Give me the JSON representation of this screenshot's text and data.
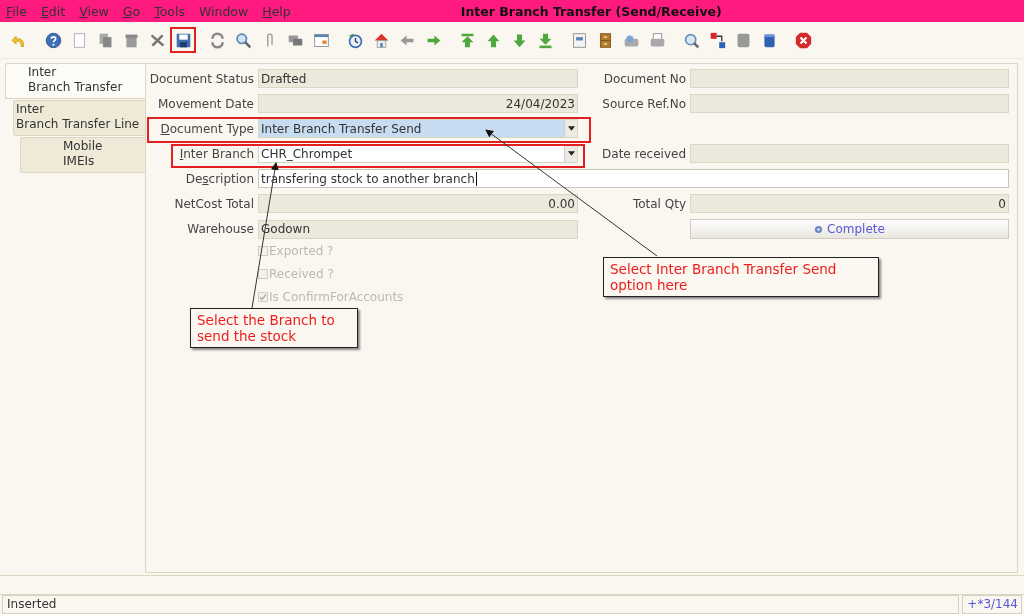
{
  "window": {
    "title": "Inter Branch Transfer (Send/Receive)"
  },
  "menu": [
    {
      "key": "F",
      "after": "ile"
    },
    {
      "key": "E",
      "after": "dit"
    },
    {
      "key": "V",
      "after": "iew"
    },
    {
      "key": "G",
      "after": "o"
    },
    {
      "key": "T",
      "after": "ools"
    },
    {
      "before": "Window"
    },
    {
      "key": "H",
      "after": "elp"
    }
  ],
  "toolbar": [
    [
      {
        "kind": "undo",
        "highlighted": false
      }
    ],
    [
      {
        "kind": "help",
        "highlighted": false
      },
      {
        "kind": "page",
        "highlighted": false
      },
      {
        "kind": "copy",
        "highlighted": false
      },
      {
        "kind": "trash",
        "highlighted": false
      },
      {
        "kind": "cross",
        "highlighted": false
      },
      {
        "kind": "floppy",
        "highlighted": true
      }
    ],
    [
      {
        "kind": "refresh",
        "highlighted": false
      },
      {
        "kind": "magnifier",
        "highlighted": false
      },
      {
        "kind": "paperclip",
        "highlighted": false
      },
      {
        "kind": "chat",
        "highlighted": false
      },
      {
        "kind": "grid",
        "highlighted": false
      }
    ],
    [
      {
        "kind": "history",
        "highlighted": false
      },
      {
        "kind": "house",
        "highlighted": false
      },
      {
        "kind": "left",
        "highlighted": false
      },
      {
        "kind": "right",
        "highlighted": false
      }
    ],
    [
      {
        "kind": "first",
        "highlighted": false
      },
      {
        "kind": "up",
        "highlighted": false
      },
      {
        "kind": "down",
        "highlighted": false
      },
      {
        "kind": "last",
        "highlighted": false
      }
    ],
    [
      {
        "kind": "report",
        "highlighted": false
      },
      {
        "kind": "cabinet",
        "highlighted": false
      },
      {
        "kind": "scanner",
        "highlighted": false
      },
      {
        "kind": "printer",
        "highlighted": false
      }
    ],
    [
      {
        "kind": "zoomdoc",
        "highlighted": false
      },
      {
        "kind": "flow",
        "highlighted": false
      },
      {
        "kind": "stack",
        "highlighted": false
      },
      {
        "kind": "cube",
        "highlighted": false
      }
    ],
    [
      {
        "kind": "close",
        "highlighted": false
      }
    ]
  ],
  "tabs": [
    {
      "label": "Inter\nBranch Transfer",
      "selected": true,
      "children": [
        {
          "label": "Inter\nBranch Transfer Line",
          "selected": false,
          "children": [
            {
              "label": "Mobile\nIMEIs",
              "selected": false
            }
          ]
        }
      ]
    }
  ],
  "form": {
    "rows": [
      {
        "left": {
          "label": {
            "before": "Document Status"
          },
          "kind": "readonly",
          "value": "Drafted"
        },
        "right": {
          "label": {
            "before": "Document No"
          },
          "kind": "readonly"
        }
      },
      {
        "left": {
          "label": {
            "before": "Movement Date"
          },
          "kind": "number",
          "value": "24/04/2023"
        },
        "right": {
          "label": {
            "before": "Source Ref.No"
          },
          "kind": "readonly"
        }
      },
      {
        "left": {
          "label": {
            "key": "D",
            "after": "ocument Type"
          },
          "kind": "dropdown",
          "value": "Inter Branch Transfer Send",
          "focused": true
        }
      },
      {
        "left": {
          "label": {
            "key": "I",
            "after": "nter Branch"
          },
          "kind": "dropdown",
          "value": "CHR_Chrompet",
          "focused": false
        },
        "right": {
          "label": {
            "before": "Date received"
          },
          "kind": "readonly"
        }
      },
      {
        "wide": {
          "label": {
            "before": "De",
            "key": "s",
            "after": "cription"
          },
          "kind": "text",
          "value": "transfering stock to another branch"
        }
      },
      {
        "left": {
          "label": {
            "before": "NetCost Total"
          },
          "kind": "number",
          "value": "0.00"
        },
        "right": {
          "label": {
            "before": "Total Qty"
          },
          "kind": "number",
          "value": "0"
        }
      },
      {
        "left": {
          "label": {
            "before": "Warehouse"
          },
          "kind": "readonly",
          "value": "Godown"
        },
        "right": {
          "kind": "button",
          "value": "Complete"
        }
      }
    ],
    "checkboxes": [
      {
        "label": "Exported ?",
        "checked": false,
        "disabled": true
      },
      {
        "label": "Received ?",
        "checked": false,
        "disabled": true
      },
      {
        "label": "Is ConfirmForAccounts",
        "checked": true,
        "disabled": true
      }
    ]
  },
  "annotations": [
    {
      "text": "Select Inter Branch Transfer Send\noption here"
    },
    {
      "text": "Select the Branch to\nsend the stock"
    }
  ],
  "status_bar": {
    "message": "Inserted",
    "record": "+*3/144"
  }
}
